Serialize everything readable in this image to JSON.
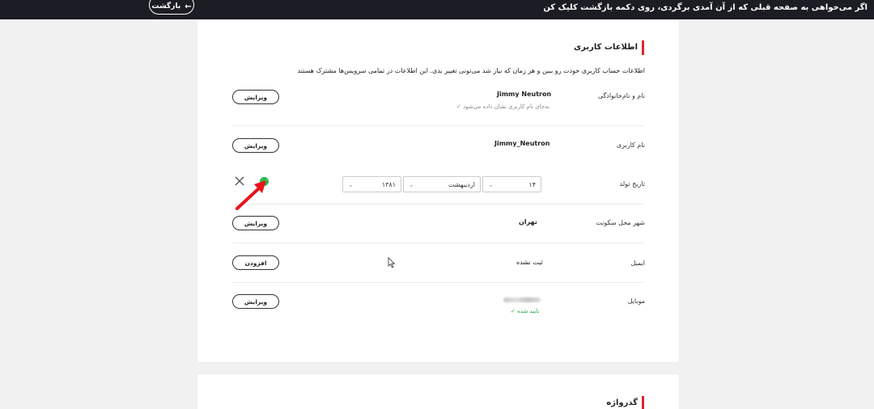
{
  "topbar": {
    "message": "اگر می‌خواهی به صفحه قبلی که از آن آمدی برگردی، روی دکمه بازگشت کلیک کن",
    "back_label": "بازگشت"
  },
  "user_info": {
    "title": "اطلاعات کاربری",
    "description": "اطلاعات حساب کاربری خودت رو ببین و هر زمان که نیاز شد می‌تونی تغییر بدی. این اطلاعات در تمامی سرویس‌ها مشترک هستند",
    "full_name": {
      "label": "نام و نام‌خانوادگی",
      "value": "Jimmy Neutron",
      "note": "به‌جای نام کاربری نشان داده می‌شود",
      "button": "ویرایش"
    },
    "username": {
      "label": "نام کاربری",
      "value": "Jimmy_Neutron",
      "button": "ویرایش"
    },
    "birthdate": {
      "label": "تاریخ تولد",
      "day": "۱۴",
      "month": "اردیبهشت",
      "year": "۱۳۸۱"
    },
    "city": {
      "label": "شهر محل سکونت",
      "value": "تهران",
      "button": "ویرایش"
    },
    "email": {
      "label": "ایمیل",
      "value": "ثبت نشده",
      "button": "افزودن"
    },
    "mobile": {
      "label": "موبایل",
      "verified": "تایید شده",
      "button": "ویرایش"
    }
  },
  "password": {
    "title": "گذرواژه"
  },
  "colors": {
    "accent": "#e0262d",
    "verified": "#2aa84a",
    "topbar": "#1c1c24"
  }
}
